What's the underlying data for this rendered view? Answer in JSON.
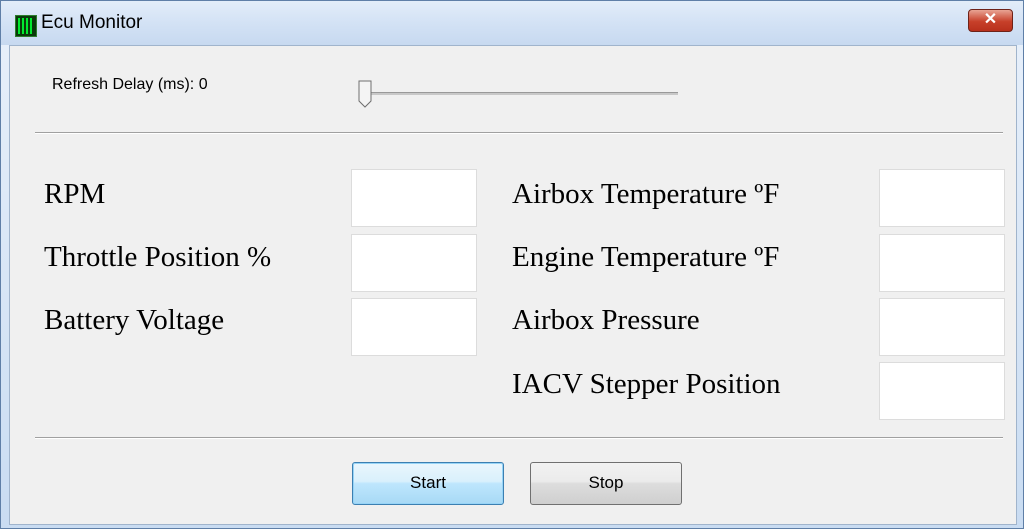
{
  "window": {
    "title": "Ecu Monitor",
    "close_label": "✕"
  },
  "refresh": {
    "label": "Refresh Delay (ms): 0",
    "slider_value_fraction": 0
  },
  "fields_left": [
    {
      "label": "RPM",
      "value": ""
    },
    {
      "label": "Throttle Position %",
      "value": ""
    },
    {
      "label": "Battery Voltage",
      "value": ""
    }
  ],
  "fields_right": [
    {
      "label": "Airbox Temperature ºF",
      "value": ""
    },
    {
      "label": "Engine Temperature ºF",
      "value": ""
    },
    {
      "label": "Airbox Pressure",
      "value": ""
    },
    {
      "label": "IACV Stepper Position",
      "value": ""
    }
  ],
  "buttons": {
    "start": "Start",
    "stop": "Stop"
  },
  "colors": {
    "titlebar": "#d3e2f5",
    "close_button": "#c7402a",
    "default_button": "#bee6fd"
  }
}
